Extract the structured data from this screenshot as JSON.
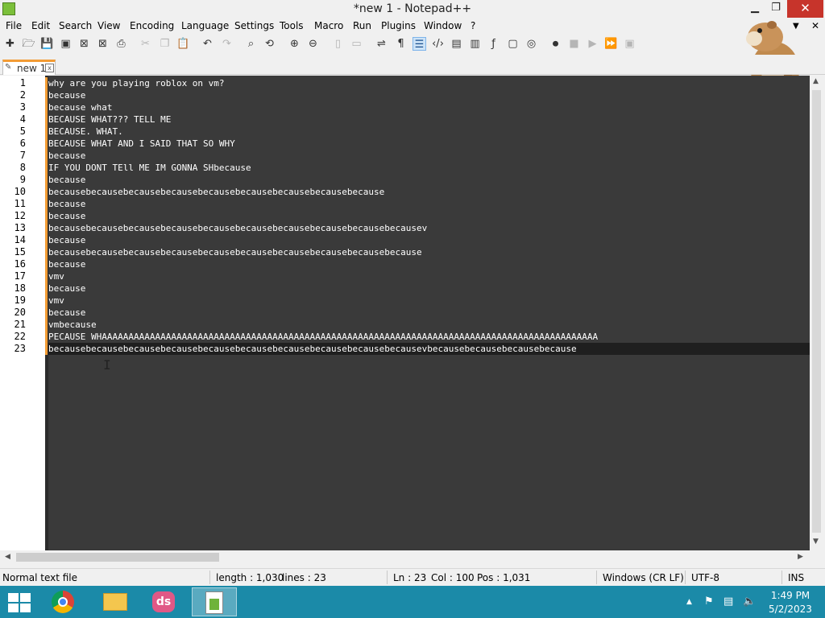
{
  "window": {
    "title": "*new 1 - Notepad++",
    "minimize": "▁",
    "maximize": "❐",
    "close": "✕"
  },
  "menu": [
    "File",
    "Edit",
    "Search",
    "View",
    "Encoding",
    "Language",
    "Settings",
    "Tools",
    "Macro",
    "Run",
    "Plugins",
    "Window",
    "?"
  ],
  "menu_extra": {
    "down_arrow": "▼",
    "close_x": "✕"
  },
  "tab": {
    "label": "new 1",
    "close": "x"
  },
  "editor": {
    "lines": [
      "why are you playing roblox on vm?",
      "because",
      "because what",
      "BECAUSE WHAT??? TELL ME",
      "BECAUSE. WHAT.",
      "BECAUSE WHAT AND I SAID THAT SO WHY",
      "because",
      "IF YOU DONT TEll ME IM GONNA SHbecause",
      "because",
      "becausebecausebecausebecausebecausebecausebecausebecausebecause",
      "because",
      "because",
      "becausebecausebecausebecausebecausebecausebecausebecausebecausebecausev",
      "because",
      "becausebecausebecausebecausebecausebecausebecausebecausebecausebecause",
      "because",
      "vmv",
      "because",
      "vmv",
      "because",
      "vmbecause",
      "PECAUSE WHAAAAAAAAAAAAAAAAAAAAAAAAAAAAAAAAAAAAAAAAAAAAAAAAAAAAAAAAAAAAAAAAAAAAAAAAAAAAAAAAAAAAAAAAAAAAA",
      "becausebecausebecausebecausebecausebecausebecausebecausebecausebecausevbecausebecausebecausebecause"
    ],
    "current_line": 23
  },
  "status": {
    "file_type": "Normal text file",
    "length": "length : 1,030",
    "lines": "lines : 23",
    "ln": "Ln : 23",
    "col": "Col : 100",
    "pos": "Pos : 1,031",
    "eol": "Windows (CR LF)",
    "encoding": "UTF-8",
    "mode": "INS"
  },
  "taskbar": {
    "time": "1:49 PM",
    "date": "5/2/2023",
    "ds_label": "ds"
  },
  "colors": {
    "editor_bg": "#3a3a3a",
    "editor_text": "#ffffff",
    "change_marker": "#f39c34",
    "taskbar": "#1b8aa8",
    "close_button": "#c7342b"
  }
}
